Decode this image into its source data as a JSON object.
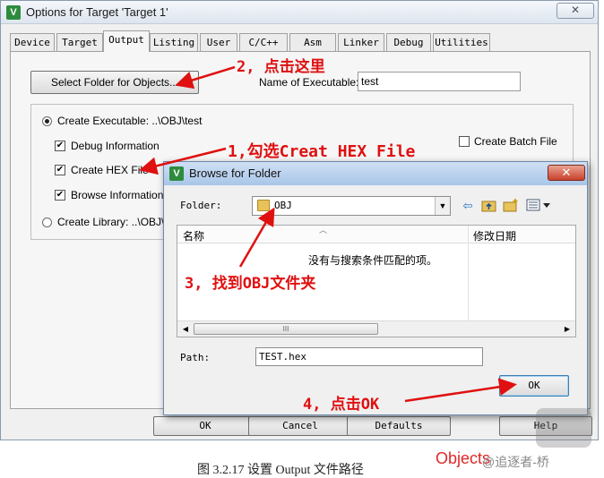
{
  "options_dialog": {
    "title": "Options for Target 'Target 1'",
    "close_glyph": "✕",
    "tabs": [
      "Device",
      "Target",
      "Output",
      "Listing",
      "User",
      "C/C++",
      "Asm",
      "Linker",
      "Debug",
      "Utilities"
    ],
    "active_tab": "Output",
    "select_folder_label": "Select Folder for Objects...",
    "name_of_executable_label": "Name of Executable:",
    "name_of_executable_value": "test",
    "create_executable_label": "Create Executable:  ..\\OBJ\\test",
    "debug_info_label": "Debug Information",
    "create_hex_label": "Create HEX File",
    "browse_info_label": "Browse Information",
    "create_library_label": "Create Library:  ..\\OBJ\\",
    "create_batch_label": "Create Batch File",
    "bottom_buttons": [
      "OK",
      "Cancel",
      "Defaults",
      "Help"
    ]
  },
  "browse_dialog": {
    "title": "Browse for Folder",
    "close_glyph": "✕",
    "folder_label": "Folder:",
    "folder_value": "OBJ",
    "columns": [
      "名称",
      "修改日期"
    ],
    "empty_message": "没有与搜索条件匹配的项。",
    "scroll_thumb": "III",
    "path_label": "Path:",
    "path_value": "TEST.hex",
    "ok_label": "OK"
  },
  "annotations": {
    "step1": "1,勾选Creat HEX File",
    "step2": "2, 点击这里",
    "step3": "3, 找到OBJ文件夹",
    "step4": "4, 点击OK"
  },
  "caption": "图 3.2.17  设置 Output 文件路径",
  "watermark": {
    "red": "Objects",
    "gray": "@追逐者-桥"
  },
  "colors": {
    "annotation": "#e01010",
    "titlebar_active": "#a9c6e8",
    "close_red": "#c8412b"
  }
}
